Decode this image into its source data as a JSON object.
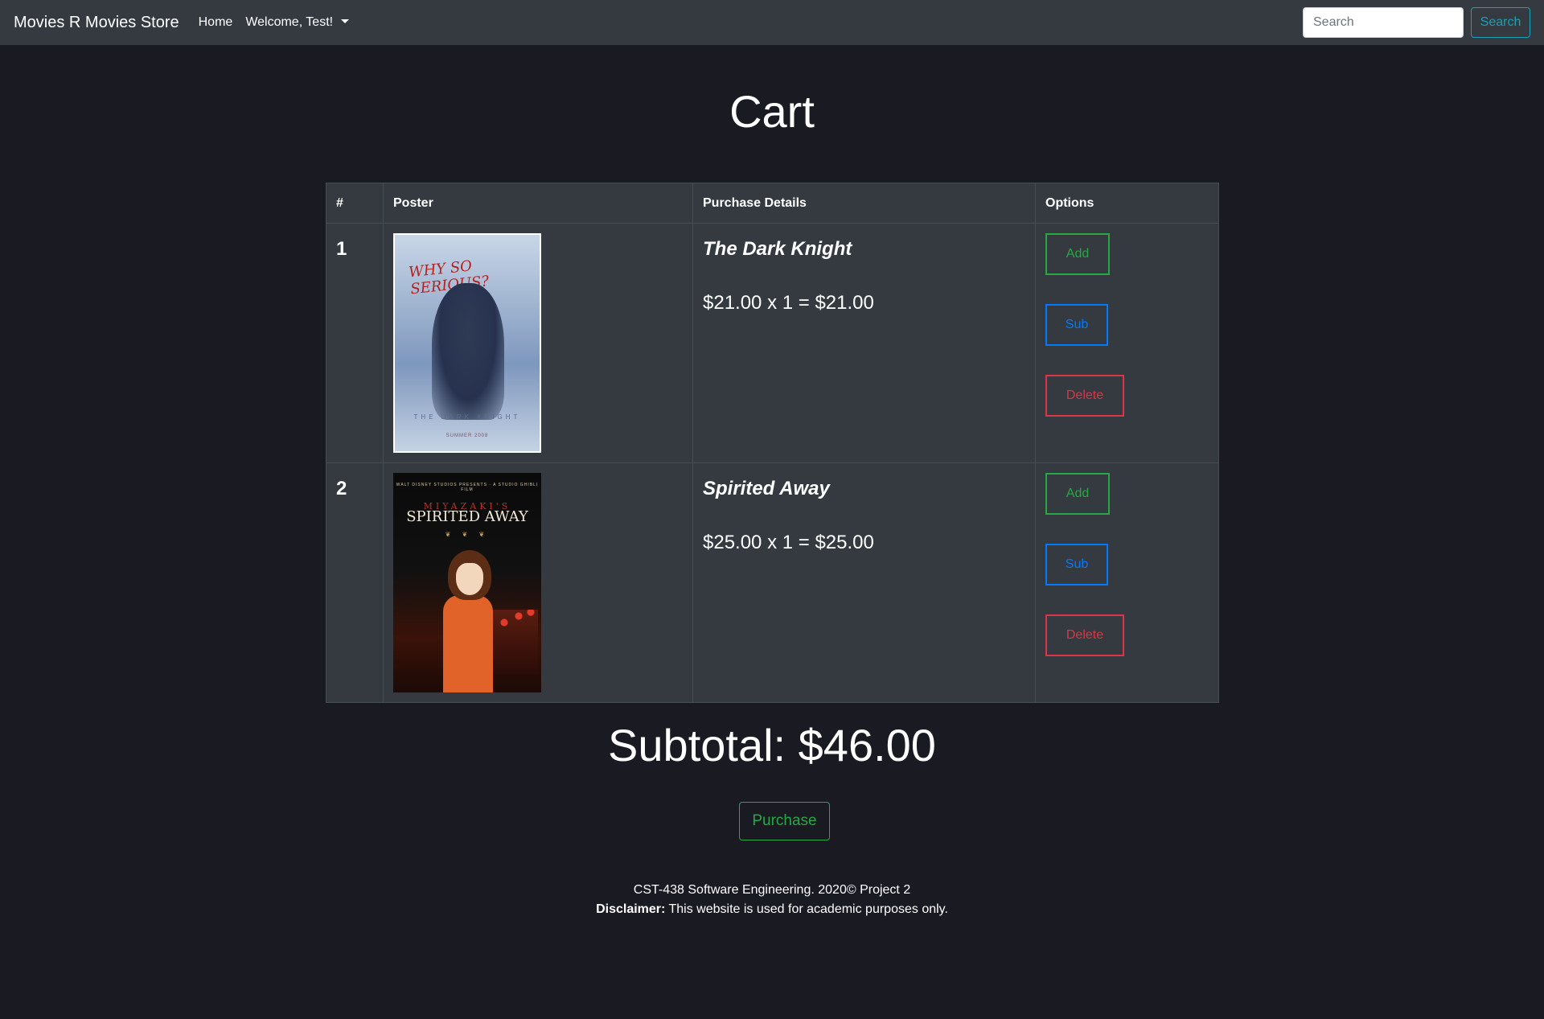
{
  "nav": {
    "brand": "Movies R Movies Store",
    "home": "Home",
    "welcome": "Welcome, Test!",
    "search_placeholder": "Search",
    "search_button": "Search"
  },
  "page": {
    "title": "Cart"
  },
  "table": {
    "headers": [
      "#",
      "Poster",
      "Purchase Details",
      "Options"
    ],
    "rows": [
      {
        "num": "1",
        "title": "The Dark Knight",
        "price_line": "$21.00 x 1 = $21.00",
        "poster": {
          "tagline": "WHY SO SERIOUS?",
          "footer": "THE DARK KNIGHT",
          "date": "SUMMER 2008"
        },
        "add": "Add",
        "sub": "Sub",
        "delete": "Delete"
      },
      {
        "num": "2",
        "title": "Spirited Away",
        "price_line": "$25.00 x 1 = $25.00",
        "poster": {
          "top": "WALT DISNEY STUDIOS PRESENTS · A STUDIO GHIBLI FILM",
          "director": "MIYAZAKI'S",
          "title": "SPIRITED AWAY"
        },
        "add": "Add",
        "sub": "Sub",
        "delete": "Delete"
      }
    ]
  },
  "subtotal": "Subtotal: $46.00",
  "purchase": "Purchase",
  "footer": {
    "line1": "CST-438 Software Engineering. 2020© Project 2",
    "disclaimer_label": "Disclaimer:",
    "disclaimer_text": " This website is used for academic purposes only."
  },
  "colors": {
    "background": "#1a1a22",
    "navbar": "#343a40",
    "success": "#28a745",
    "primary": "#007bff",
    "danger": "#dc3545",
    "info": "#17a2b8"
  }
}
